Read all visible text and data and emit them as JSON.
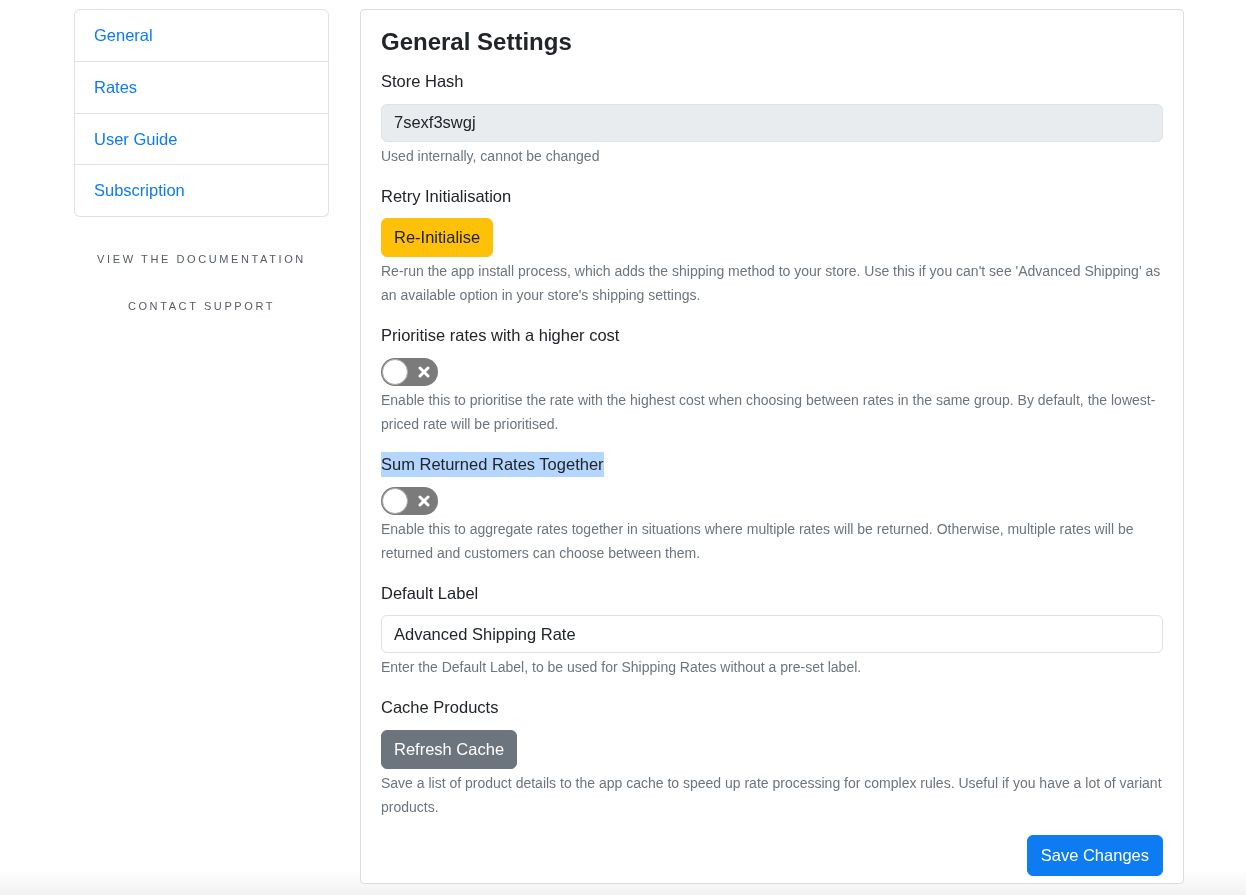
{
  "sidebar": {
    "items": [
      {
        "label": "General",
        "selected": false
      },
      {
        "label": "Rates",
        "selected": false
      },
      {
        "label": "User Guide",
        "selected": false
      },
      {
        "label": "Subscription",
        "selected": false
      }
    ],
    "links": [
      "VIEW THE DOCUMENTATION",
      "CONTACT SUPPORT"
    ]
  },
  "settings": {
    "title": "General Settings",
    "fields": [
      {
        "kind": "readonly",
        "label": "Store Hash",
        "value": "7sexf3swgj",
        "help": "Used internally, cannot be changed"
      },
      {
        "kind": "action",
        "label": "Retry Initialisation",
        "button": "Re-Initialise",
        "help": "Re-run the app install process, which adds the shipping method to your store. Use this if you can't see 'Advanced Shipping' as an available option in your store's shipping settings."
      },
      {
        "kind": "toggle",
        "label": "Prioritise rates with a higher cost",
        "on": false,
        "label_highlighted": false,
        "help": "Enable this to prioritise the rate with the highest cost when choosing between rates in the same group. By default, the lowest-priced rate will be prioritised."
      },
      {
        "kind": "toggle",
        "label": "Sum Returned Rates Together",
        "on": false,
        "label_highlighted": true,
        "help": "Enable this to aggregate rates together in situations where multiple rates will be returned. Otherwise, multiple rates will be returned and customers can choose between them."
      },
      {
        "kind": "input",
        "label": "Default Label",
        "value": "Advanced Shipping Rate",
        "help": "Enter the Default Label, to be used for Shipping Rates without a pre-set label."
      },
      {
        "kind": "utility",
        "label": "Cache Products",
        "button": "Refresh Cache",
        "help": "Save a list of product details to the app cache to speed up rate processing for complex rules. Useful if you have a lot of variant products."
      }
    ],
    "save_button": "Save Changes"
  }
}
